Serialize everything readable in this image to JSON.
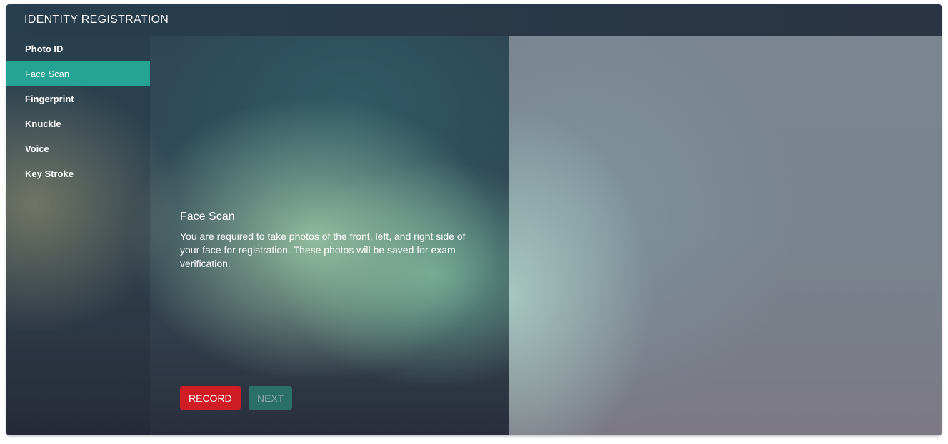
{
  "window": {
    "title": "IDENTITY REGISTRATION"
  },
  "sidebar": {
    "items": [
      {
        "label": "Photo ID",
        "active": false
      },
      {
        "label": "Face Scan",
        "active": true
      },
      {
        "label": "Fingerprint",
        "active": false
      },
      {
        "label": "Knuckle",
        "active": false
      },
      {
        "label": "Voice",
        "active": false
      },
      {
        "label": "Key Stroke",
        "active": false
      }
    ]
  },
  "main": {
    "section_title": "Face Scan",
    "section_description": "You are required to take photos of the front, left, and right side of your face for registration. These photos will be saved for exam verification.",
    "record_label": "RECORD",
    "next_label": "NEXT"
  },
  "colors": {
    "accent": "#25a394",
    "record": "#d01c24",
    "next_disabled": "#2b6f69"
  }
}
